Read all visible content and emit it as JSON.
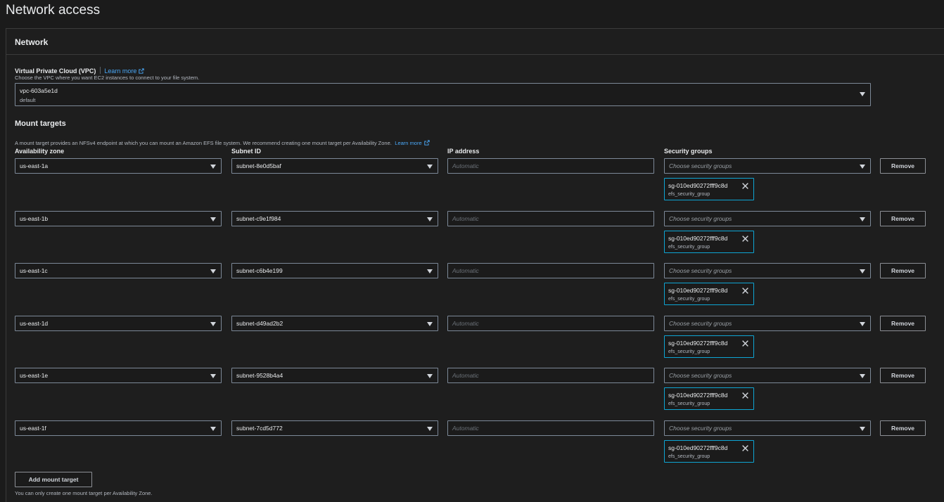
{
  "page": {
    "title": "Network access"
  },
  "network": {
    "title": "Network"
  },
  "vpc": {
    "label": "Virtual Private Cloud (VPC)",
    "learn_more": "Learn more",
    "description": "Choose the VPC where you want EC2 instances to connect to your file system.",
    "value": "vpc-603a5e1d",
    "sub": "default"
  },
  "mount_targets": {
    "title": "Mount targets",
    "description": "A mount target provides an NFSv4 endpoint at which you can mount an Amazon EFS file system. We recommend creating one mount target per Availability Zone.",
    "learn_more": "Learn more",
    "columns": {
      "az": "Availability zone",
      "subnet": "Subnet ID",
      "ip": "IP address",
      "sg": "Security groups"
    },
    "ip_placeholder": "Automatic",
    "sg_placeholder": "Choose security groups",
    "remove_label": "Remove",
    "rows": [
      {
        "az": "us-east-1a",
        "subnet": "subnet-8e0d5baf",
        "sg_id": "sg-010ed90272fff9c8d",
        "sg_name": "efs_security_group"
      },
      {
        "az": "us-east-1b",
        "subnet": "subnet-c9e1f984",
        "sg_id": "sg-010ed90272fff9c8d",
        "sg_name": "efs_security_group"
      },
      {
        "az": "us-east-1c",
        "subnet": "subnet-c6b4e199",
        "sg_id": "sg-010ed90272fff9c8d",
        "sg_name": "efs_security_group"
      },
      {
        "az": "us-east-1d",
        "subnet": "subnet-d49ad2b2",
        "sg_id": "sg-010ed90272fff9c8d",
        "sg_name": "efs_security_group"
      },
      {
        "az": "us-east-1e",
        "subnet": "subnet-9528b4a4",
        "sg_id": "sg-010ed90272fff9c8d",
        "sg_name": "efs_security_group"
      },
      {
        "az": "us-east-1f",
        "subnet": "subnet-7cd5d772",
        "sg_id": "sg-010ed90272fff9c8d",
        "sg_name": "efs_security_group"
      }
    ],
    "add_label": "Add mount target",
    "footnote": "You can only create one mount target per Availability Zone."
  },
  "colors": {
    "background": "#1b1b1b",
    "link": "#4aa8f7",
    "token_border": "#0ea5d4",
    "control_border": "#7d8998"
  },
  "icons": {
    "external_link": "external-link-icon",
    "caret": "caret-down-icon",
    "dismiss": "close-icon"
  }
}
